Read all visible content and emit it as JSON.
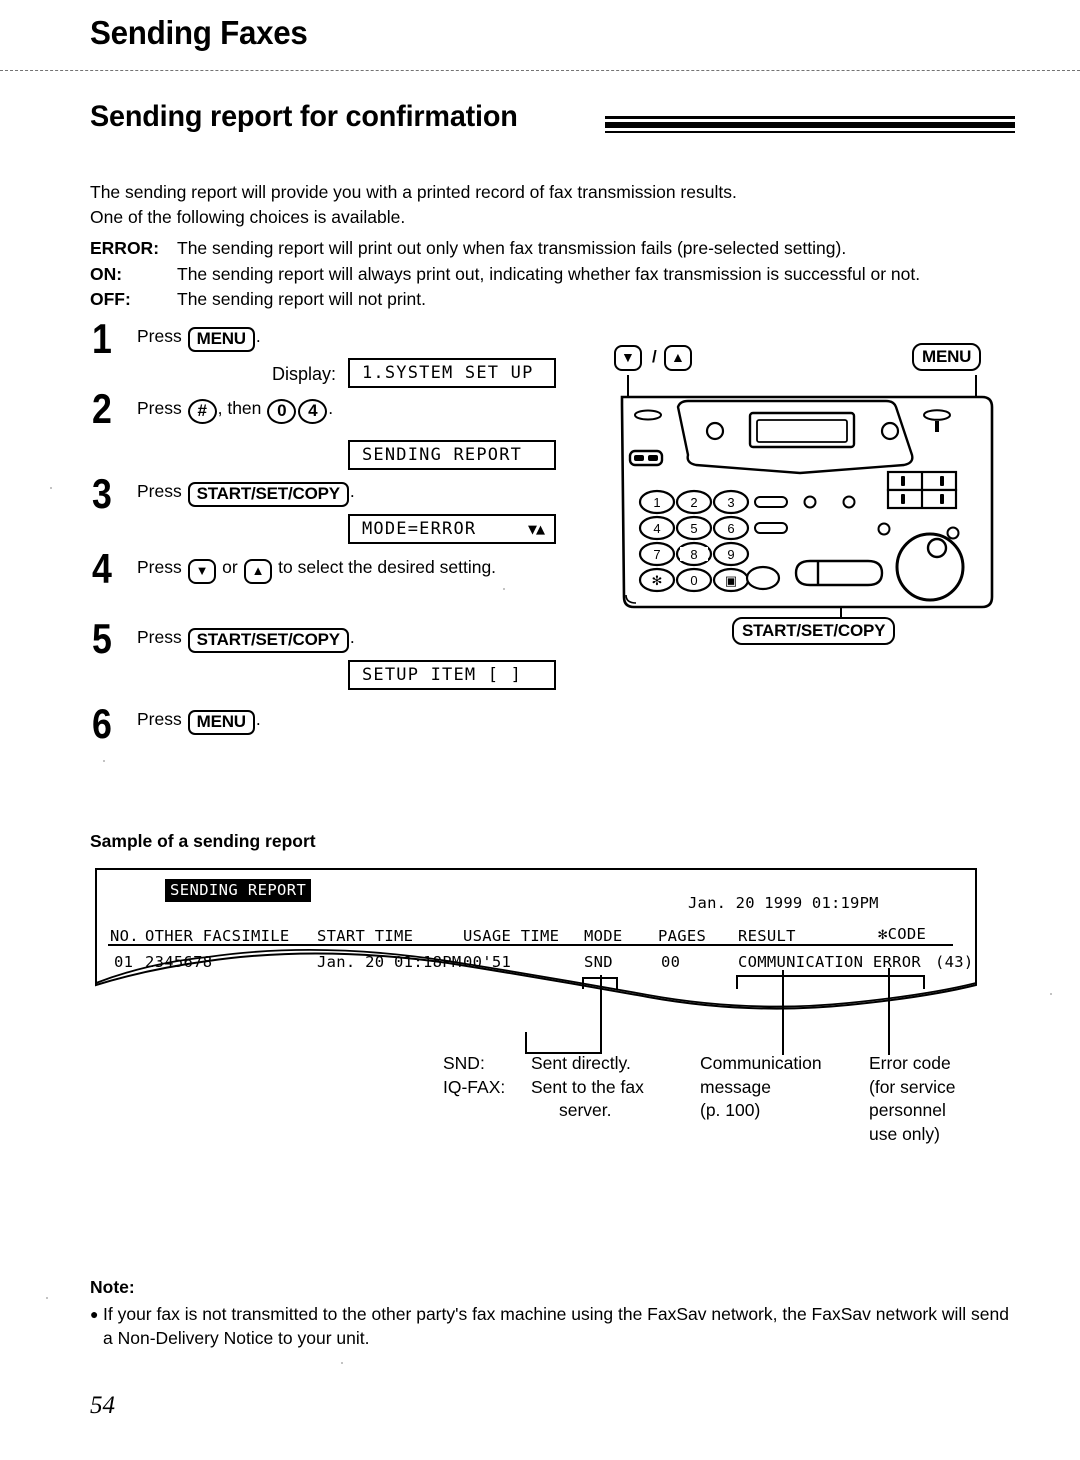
{
  "header": {
    "chapter": "Sending Faxes",
    "section": "Sending report for confirmation"
  },
  "intro": {
    "line1": "The sending report will provide you with a printed record of fax transmission results.",
    "line2": "One of the following choices is available."
  },
  "choices": [
    {
      "key": "ERROR:",
      "text": "The sending report will print out only when fax transmission fails (pre-selected setting)."
    },
    {
      "key": "ON:",
      "text": "The sending report will always print out, indicating whether fax transmission is successful or not."
    },
    {
      "key": "OFF:",
      "text": "The sending report will not print."
    }
  ],
  "steps": {
    "s1": {
      "num": "1",
      "press": "Press",
      "key": "MENU",
      "period": ".",
      "display_label": "Display:",
      "lcd": "1.SYSTEM SET UP"
    },
    "s2": {
      "num": "2",
      "press": "Press",
      "key1": "#",
      "then": ", then",
      "key2": "0",
      "key3": "4",
      "period": ".",
      "lcd": "SENDING REPORT"
    },
    "s3": {
      "num": "3",
      "press": "Press",
      "key": "START/SET/COPY",
      "period": ".",
      "lcd": "MODE=ERROR",
      "lcd_arrows": "▼▲"
    },
    "s4": {
      "num": "4",
      "press": "Press",
      "key_down": "▼",
      "or": "or",
      "key_up": "▲",
      "tail": "to select the desired setting."
    },
    "s5": {
      "num": "5",
      "press": "Press",
      "key": "START/SET/COPY",
      "period": ".",
      "lcd": "SETUP ITEM [  ]"
    },
    "s6": {
      "num": "6",
      "press": "Press",
      "key": "MENU",
      "period": "."
    }
  },
  "fax_art": {
    "callout_updown": {
      "down": "▼",
      "slash": "/",
      "up": "▲"
    },
    "callout_menu": "MENU",
    "callout_start": "START/SET/COPY",
    "keypad": [
      "1",
      "2",
      "3",
      "4",
      "5",
      "6",
      "7",
      "8",
      "9",
      "✻",
      "0",
      "▣"
    ]
  },
  "sample": {
    "heading": "Sample of a sending report",
    "banner": "SENDING REPORT",
    "date": "Jan. 20 1999 01:19PM",
    "columns": [
      "NO.",
      "OTHER FACSIMILE",
      "START TIME",
      "USAGE TIME",
      "MODE",
      "PAGES",
      "RESULT",
      "✻CODE"
    ],
    "row": {
      "no": "01",
      "other_facsimile": "2345678",
      "start_time": "Jan. 20 01:18PM",
      "usage_time": "00'51",
      "mode": "SND",
      "pages": "00",
      "result": "COMMUNICATION ERROR",
      "code": "(43)"
    }
  },
  "callouts": {
    "mode": {
      "k1": "SND:",
      "v1": "Sent directly.",
      "k2": "IQ-FAX:",
      "v2": "Sent to the fax",
      "v2b": "server."
    },
    "message": {
      "l1": "Communication",
      "l2": "message",
      "l3": "(p. 100)"
    },
    "errorcode": {
      "l1": "Error code",
      "l2": "(for service",
      "l3": "personnel",
      "l4": "use only)"
    }
  },
  "note": {
    "heading": "Note:",
    "bullet": "●",
    "text": "If your fax is not transmitted to the other party's fax machine using the FaxSav network, the FaxSav network will send a Non-Delivery Notice to your unit."
  },
  "page_number": "54"
}
